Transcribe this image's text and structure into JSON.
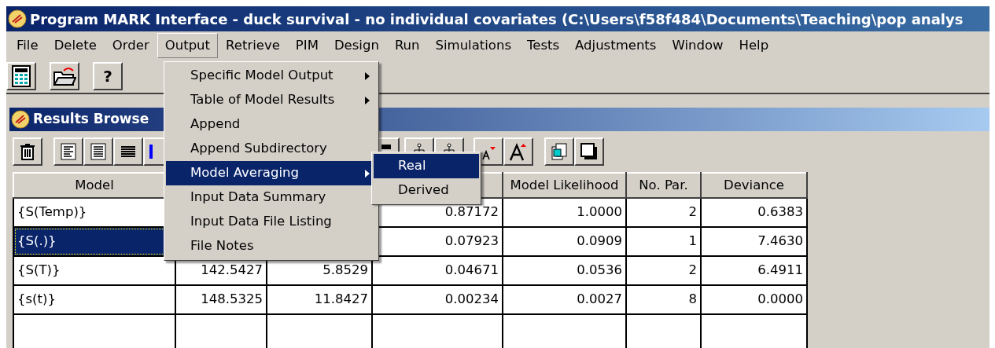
{
  "window": {
    "title": "Program MARK Interface - duck survival - no individual covariates  (C:\\Users\\f58f484\\Documents\\Teaching\\pop analys"
  },
  "menu_bar": [
    {
      "label": "File",
      "selected": false
    },
    {
      "label": "Delete",
      "selected": false
    },
    {
      "label": "Order",
      "selected": false
    },
    {
      "label": "Output",
      "selected": true
    },
    {
      "label": "Retrieve",
      "selected": false
    },
    {
      "label": "PIM",
      "selected": false
    },
    {
      "label": "Design",
      "selected": false
    },
    {
      "label": "Run",
      "selected": false
    },
    {
      "label": "Simulations",
      "selected": false
    },
    {
      "label": "Tests",
      "selected": false
    },
    {
      "label": "Adjustments",
      "selected": false
    },
    {
      "label": "Window",
      "selected": false
    },
    {
      "label": "Help",
      "selected": false
    }
  ],
  "toolbar": {
    "help_button": "?"
  },
  "output_menu": [
    {
      "label": "Specific Model Output",
      "has_submenu": true,
      "selected": false
    },
    {
      "label": "Table of Model Results",
      "has_submenu": true,
      "selected": false
    },
    {
      "label": "Append",
      "has_submenu": false,
      "selected": false
    },
    {
      "label": "Append Subdirectory",
      "has_submenu": false,
      "selected": false
    },
    {
      "label": "Model Averaging",
      "has_submenu": true,
      "selected": true
    },
    {
      "label": "Input Data Summary",
      "has_submenu": false,
      "selected": false
    },
    {
      "label": "Input Data File Listing",
      "has_submenu": false,
      "selected": false
    },
    {
      "label": "File Notes",
      "has_submenu": false,
      "selected": false
    }
  ],
  "model_averaging_submenu": [
    {
      "label": "Real",
      "selected": true
    },
    {
      "label": "Derived",
      "selected": false
    }
  ],
  "results_window": {
    "title": "Results Browse"
  },
  "table": {
    "columns": [
      "Model",
      "",
      "",
      "",
      "Model Likelihood",
      "No. Par.",
      "Deviance"
    ],
    "rows": [
      {
        "selected": false,
        "cells": [
          "{S(Temp)}",
          null,
          null,
          "0.87172",
          "1.0000",
          "2",
          "0.6383"
        ]
      },
      {
        "selected": true,
        "cells": [
          "{S(.)}",
          null,
          null,
          "0.07923",
          "0.0909",
          "1",
          "7.4630"
        ]
      },
      {
        "selected": false,
        "cells": [
          "{S(T)}",
          "142.5427",
          "5.8529",
          "0.04671",
          "0.0536",
          "2",
          "6.4911"
        ]
      },
      {
        "selected": false,
        "cells": [
          "{s(t)}",
          "148.5325",
          "11.8427",
          "0.00234",
          "0.0027",
          "8",
          "0.0000"
        ]
      }
    ]
  }
}
